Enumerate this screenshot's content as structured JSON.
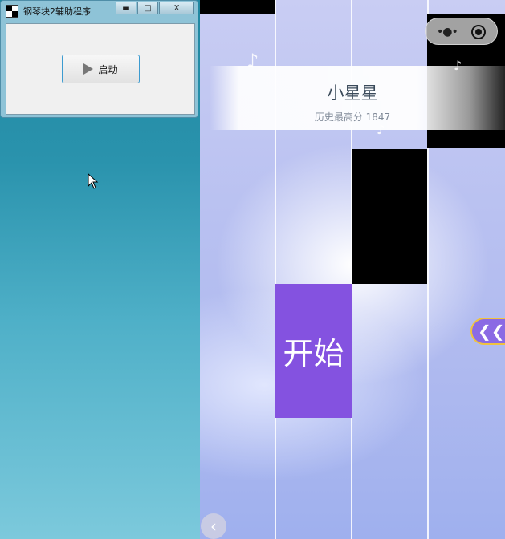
{
  "window": {
    "title": "钢琴块2辅助程序",
    "minimize_glyph": "▬",
    "maximize_glyph": "□",
    "close_glyph": "X",
    "start_label": "启动",
    "icons": [
      "app-icon",
      "play-icon"
    ]
  },
  "game": {
    "song_title": "小星星",
    "high_score": "历史最高分 1847",
    "start_tile_label": "开始",
    "side_tab_glyph": "❮❮",
    "back_glyph": "‹",
    "menu_glyph": "•●•",
    "colors": {
      "start_tile": "#8452e0",
      "tile": "#000000",
      "side_tab_border": "#f0c23e"
    },
    "icons": [
      "music-note-icon",
      "more-icon",
      "close-target-icon",
      "chevron-left-icon"
    ]
  }
}
